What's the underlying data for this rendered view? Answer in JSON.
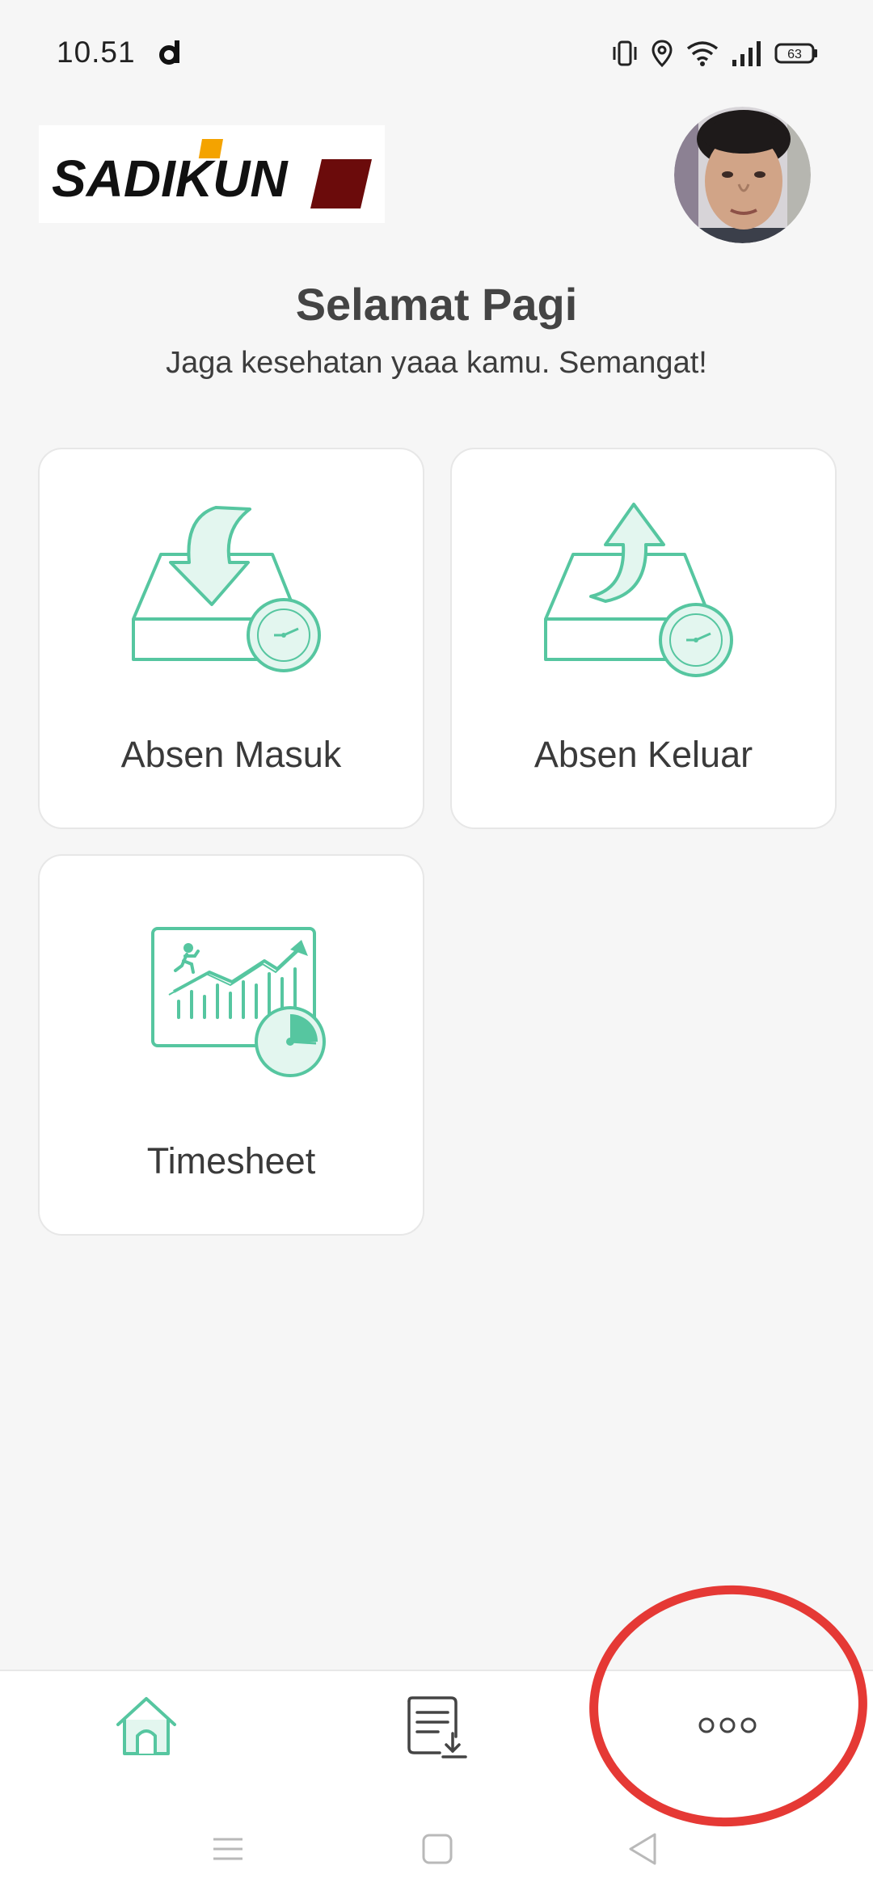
{
  "status_bar": {
    "time": "10.51",
    "battery": "63",
    "icons": [
      "app-d-icon",
      "vibrate-icon",
      "location-icon",
      "wifi-icon",
      "signal-icon",
      "battery-icon"
    ]
  },
  "header": {
    "logo_text": "SADIKUN",
    "brand_colors": {
      "accent": "#f4a300",
      "dark_red": "#6b0b0b"
    }
  },
  "greeting": {
    "title": "Selamat Pagi",
    "subtitle": "Jaga kesehatan yaaa kamu. Semangat!"
  },
  "menu": [
    {
      "label": "Absen Masuk",
      "icon": "tray-download-clock-icon"
    },
    {
      "label": "Absen Keluar",
      "icon": "tray-upload-clock-icon"
    },
    {
      "label": "Timesheet",
      "icon": "chart-runner-clock-icon"
    }
  ],
  "bottom_nav": [
    {
      "name": "home",
      "icon": "home-icon",
      "active": true
    },
    {
      "name": "report",
      "icon": "document-download-icon",
      "active": false
    },
    {
      "name": "more",
      "icon": "more-dots-icon",
      "active": false
    }
  ],
  "colors": {
    "accent": "#56c6a0",
    "accent_light": "#e3f6ef",
    "annotation": "#e53935"
  }
}
